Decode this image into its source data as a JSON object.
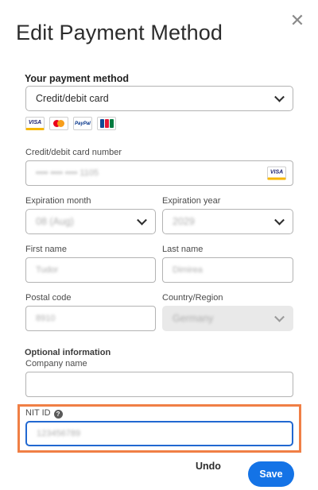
{
  "dialog": {
    "title": "Edit Payment Method",
    "close_icon": "close-icon"
  },
  "payment": {
    "section_label": "Your payment method",
    "method_value": "Credit/debit card",
    "card_brands": [
      "VISA",
      "Mastercard",
      "PayPal",
      "JCB"
    ]
  },
  "fields": {
    "card_number": {
      "label": "Credit/debit card number",
      "value": "•••• •••• •••• 1105"
    },
    "exp_month": {
      "label": "Expiration month",
      "value": "08 (Aug)"
    },
    "exp_year": {
      "label": "Expiration year",
      "value": "2029"
    },
    "first_name": {
      "label": "First name",
      "value": "Tudor"
    },
    "last_name": {
      "label": "Last name",
      "value": "Dimirea"
    },
    "postal_code": {
      "label": "Postal code",
      "value": "8910"
    },
    "country": {
      "label": "Country/Region",
      "value": "Germany"
    }
  },
  "optional": {
    "section_label": "Optional information",
    "company": {
      "label": "Company name",
      "value": ""
    },
    "nit": {
      "label": "NIT ID",
      "value": "123456789"
    }
  },
  "footer": {
    "undo_label": "Undo",
    "save_label": "Save"
  },
  "colors": {
    "accent": "#1473e6",
    "highlight": "#f07f45",
    "focus": "#2168d1"
  }
}
